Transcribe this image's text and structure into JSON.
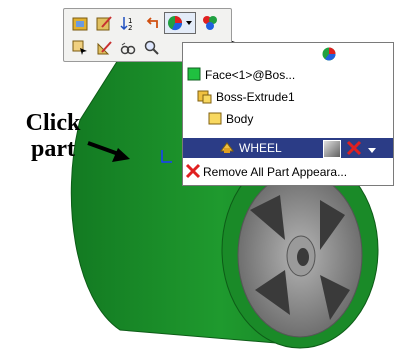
{
  "callout": {
    "line1": "Click",
    "line2": "part"
  },
  "toolbar": {
    "row1": [
      "properties-icon",
      "edit-appearance-icon",
      "sort-icon",
      "back-arrow-icon",
      "appearance-dropdown-icon",
      "appearance-balls-icon"
    ],
    "row2": [
      "select-icon",
      "sketch-icon",
      "view-icon",
      "zoom-icon"
    ]
  },
  "menu": {
    "header_icon": "appearance-ball-icon",
    "items": [
      {
        "label": "Face<1>@Bos...",
        "icon": "face-icon"
      },
      {
        "label": "Boss-Extrude1",
        "icon": "feature-icon"
      },
      {
        "label": "Body",
        "icon": "body-icon"
      },
      {
        "label": "WHEEL",
        "icon": "part-icon",
        "selected": true
      },
      {
        "label": "Remove All Part Appeara...",
        "icon": "red-x-icon"
      }
    ]
  },
  "colors": {
    "wheel_green": "#1d8a2a",
    "selected_row": "#2b3c86",
    "hub_gray": "#8c8c8c"
  }
}
